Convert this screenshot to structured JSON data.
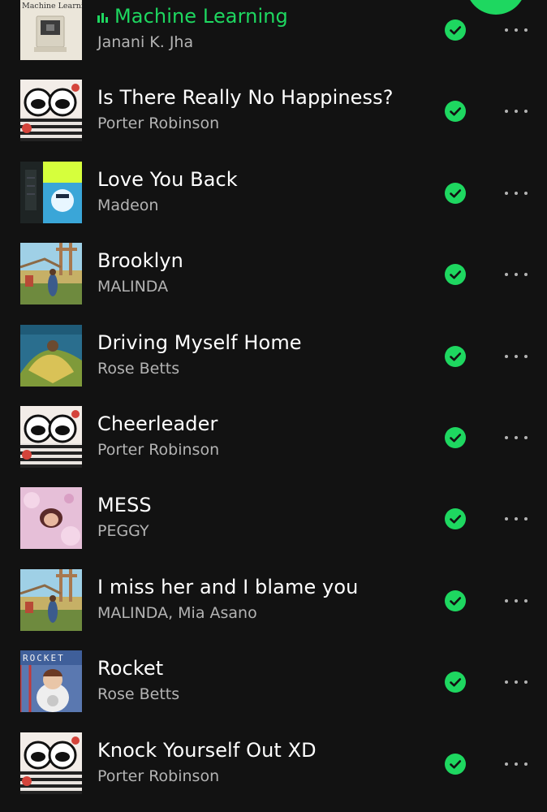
{
  "colors": {
    "accent": "#1ed760",
    "background": "#121212",
    "title": "#ffffff",
    "subtitle": "#b3b3b3"
  },
  "album_art_text": {
    "machine_learning": "Machine Learning.",
    "rocket": "ROCKET"
  },
  "tracks": [
    {
      "title": "Machine Learning",
      "artist": "Janani K. Jha",
      "playing": true,
      "art": "machine-learning-cover",
      "downloaded": true
    },
    {
      "title": "Is There Really No Happiness?",
      "artist": "Porter Robinson",
      "playing": false,
      "art": "nurture-cover",
      "downloaded": true
    },
    {
      "title": "Love You Back",
      "artist": "Madeon",
      "playing": false,
      "art": "good-faith-cover",
      "downloaded": true
    },
    {
      "title": "Brooklyn",
      "artist": "MALINDA",
      "playing": false,
      "art": "brooklyn-cover",
      "downloaded": true
    },
    {
      "title": "Driving Myself Home",
      "artist": "Rose Betts",
      "playing": false,
      "art": "white-orchids-cover",
      "downloaded": true
    },
    {
      "title": "Cheerleader",
      "artist": "Porter Robinson",
      "playing": false,
      "art": "nurture-cover",
      "downloaded": true
    },
    {
      "title": "MESS",
      "artist": "PEGGY",
      "playing": false,
      "art": "mess-cover",
      "downloaded": true
    },
    {
      "title": "I miss her and I blame you",
      "artist": "MALINDA, Mia Asano",
      "playing": false,
      "art": "brooklyn-cover",
      "downloaded": true
    },
    {
      "title": "Rocket",
      "artist": "Rose Betts",
      "playing": false,
      "art": "rocket-cover",
      "downloaded": true
    },
    {
      "title": "Knock Yourself Out XD",
      "artist": "Porter Robinson",
      "playing": false,
      "art": "nurture-cover",
      "downloaded": true
    }
  ]
}
